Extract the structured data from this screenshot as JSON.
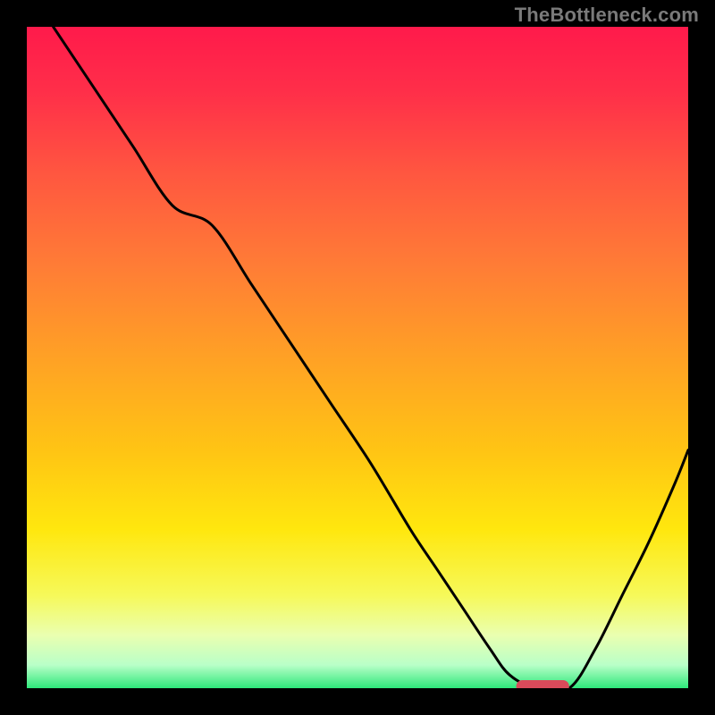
{
  "watermark": "TheBottleneck.com",
  "colors": {
    "black": "#000000",
    "curve": "#000000",
    "marker": "#d94a5a",
    "gradient_stops": [
      {
        "offset": 0.0,
        "color": "#ff1a4b"
      },
      {
        "offset": 0.1,
        "color": "#ff2f49"
      },
      {
        "offset": 0.22,
        "color": "#ff5640"
      },
      {
        "offset": 0.36,
        "color": "#ff7c36"
      },
      {
        "offset": 0.5,
        "color": "#ffa125"
      },
      {
        "offset": 0.64,
        "color": "#ffc414"
      },
      {
        "offset": 0.76,
        "color": "#ffe70e"
      },
      {
        "offset": 0.86,
        "color": "#f6f95a"
      },
      {
        "offset": 0.92,
        "color": "#eaffb0"
      },
      {
        "offset": 0.965,
        "color": "#b9ffc8"
      },
      {
        "offset": 1.0,
        "color": "#2ee87a"
      }
    ]
  },
  "chart_data": {
    "type": "line",
    "title": "",
    "xlabel": "",
    "ylabel": "",
    "xlim": [
      0,
      100
    ],
    "ylim": [
      0,
      100
    ],
    "x": [
      4,
      10,
      16,
      22,
      28,
      34,
      40,
      46,
      52,
      58,
      62,
      66,
      70,
      73,
      77,
      82,
      86,
      90,
      94,
      98,
      100
    ],
    "y": [
      100,
      91,
      82,
      73,
      70,
      61,
      52,
      43,
      34,
      24,
      18,
      12,
      6,
      2,
      0,
      0,
      6,
      14,
      22,
      31,
      36
    ],
    "marker": {
      "x_start": 74,
      "x_end": 82,
      "y": 0
    }
  }
}
